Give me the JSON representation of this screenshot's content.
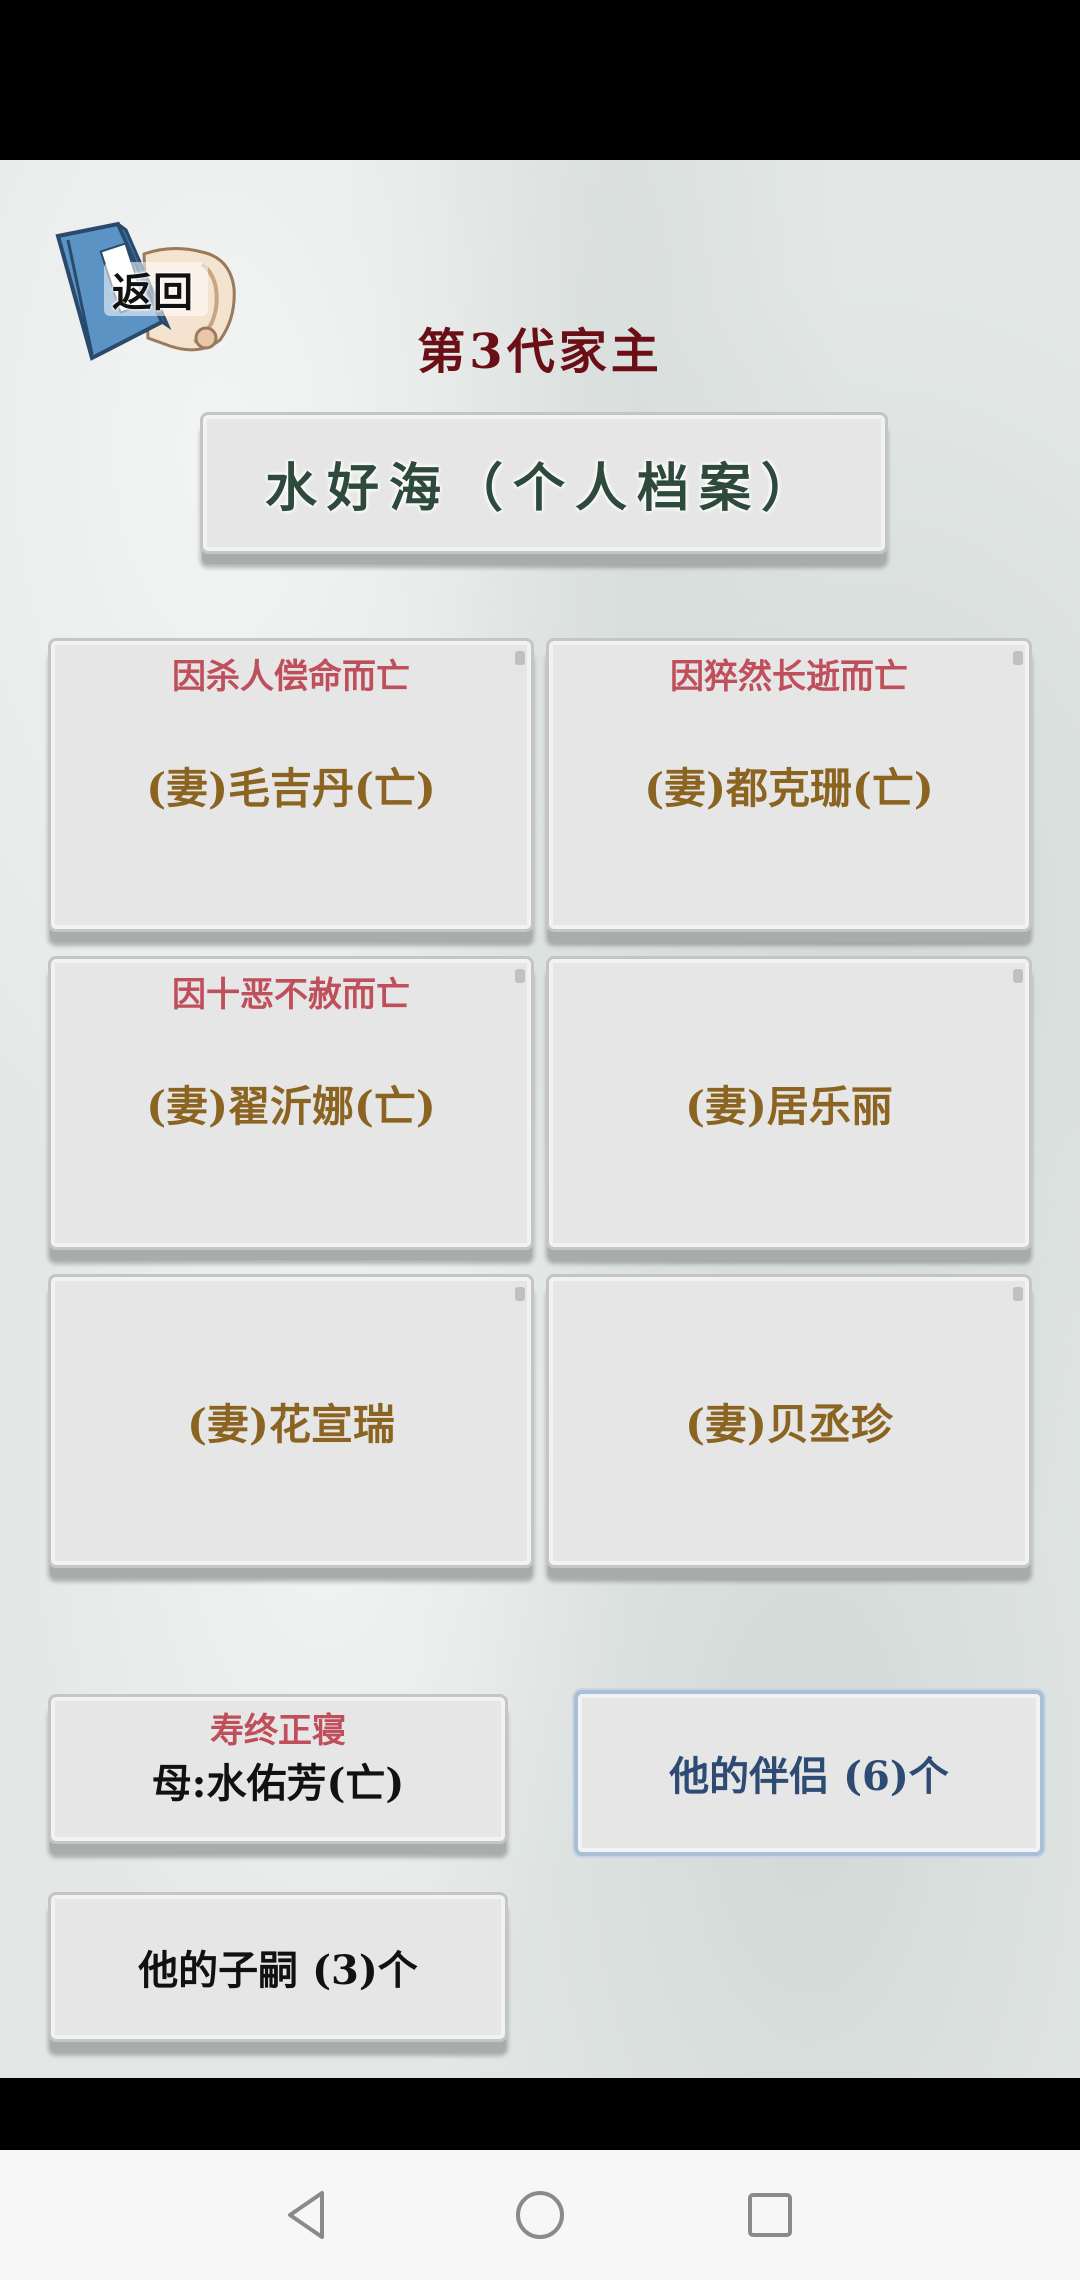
{
  "header": {
    "back_label": "返回",
    "generation_title": "第3代家主",
    "person_title": "水好海（个人档案）"
  },
  "spouses": [
    {
      "cause": "因杀人偿命而亡",
      "name": "(妻)毛吉丹(亡)"
    },
    {
      "cause": "因猝然长逝而亡",
      "name": "(妻)都克珊(亡)"
    },
    {
      "cause": "因十恶不赦而亡",
      "name": "(妻)翟沂娜(亡)"
    },
    {
      "cause": "",
      "name": "(妻)居乐丽"
    },
    {
      "cause": "",
      "name": "(妻)花宣瑞"
    },
    {
      "cause": "",
      "name": "(妻)贝丞珍"
    }
  ],
  "mother": {
    "cause": "寿终正寝",
    "name": "母:水佑芳(亡)"
  },
  "partners_button": "他的伴侣 (6)个",
  "children_button": "他的子嗣 (3)个",
  "colors": {
    "title_dark_red": "#6b0f16",
    "cause_red": "#c04f5c",
    "spouse_gold": "#8a6420",
    "name_green": "#2e4a3c",
    "partners_blue": "#2d4b73"
  },
  "nav": {
    "icons": [
      "back-triangle-icon",
      "home-circle-icon",
      "recents-square-icon"
    ]
  }
}
